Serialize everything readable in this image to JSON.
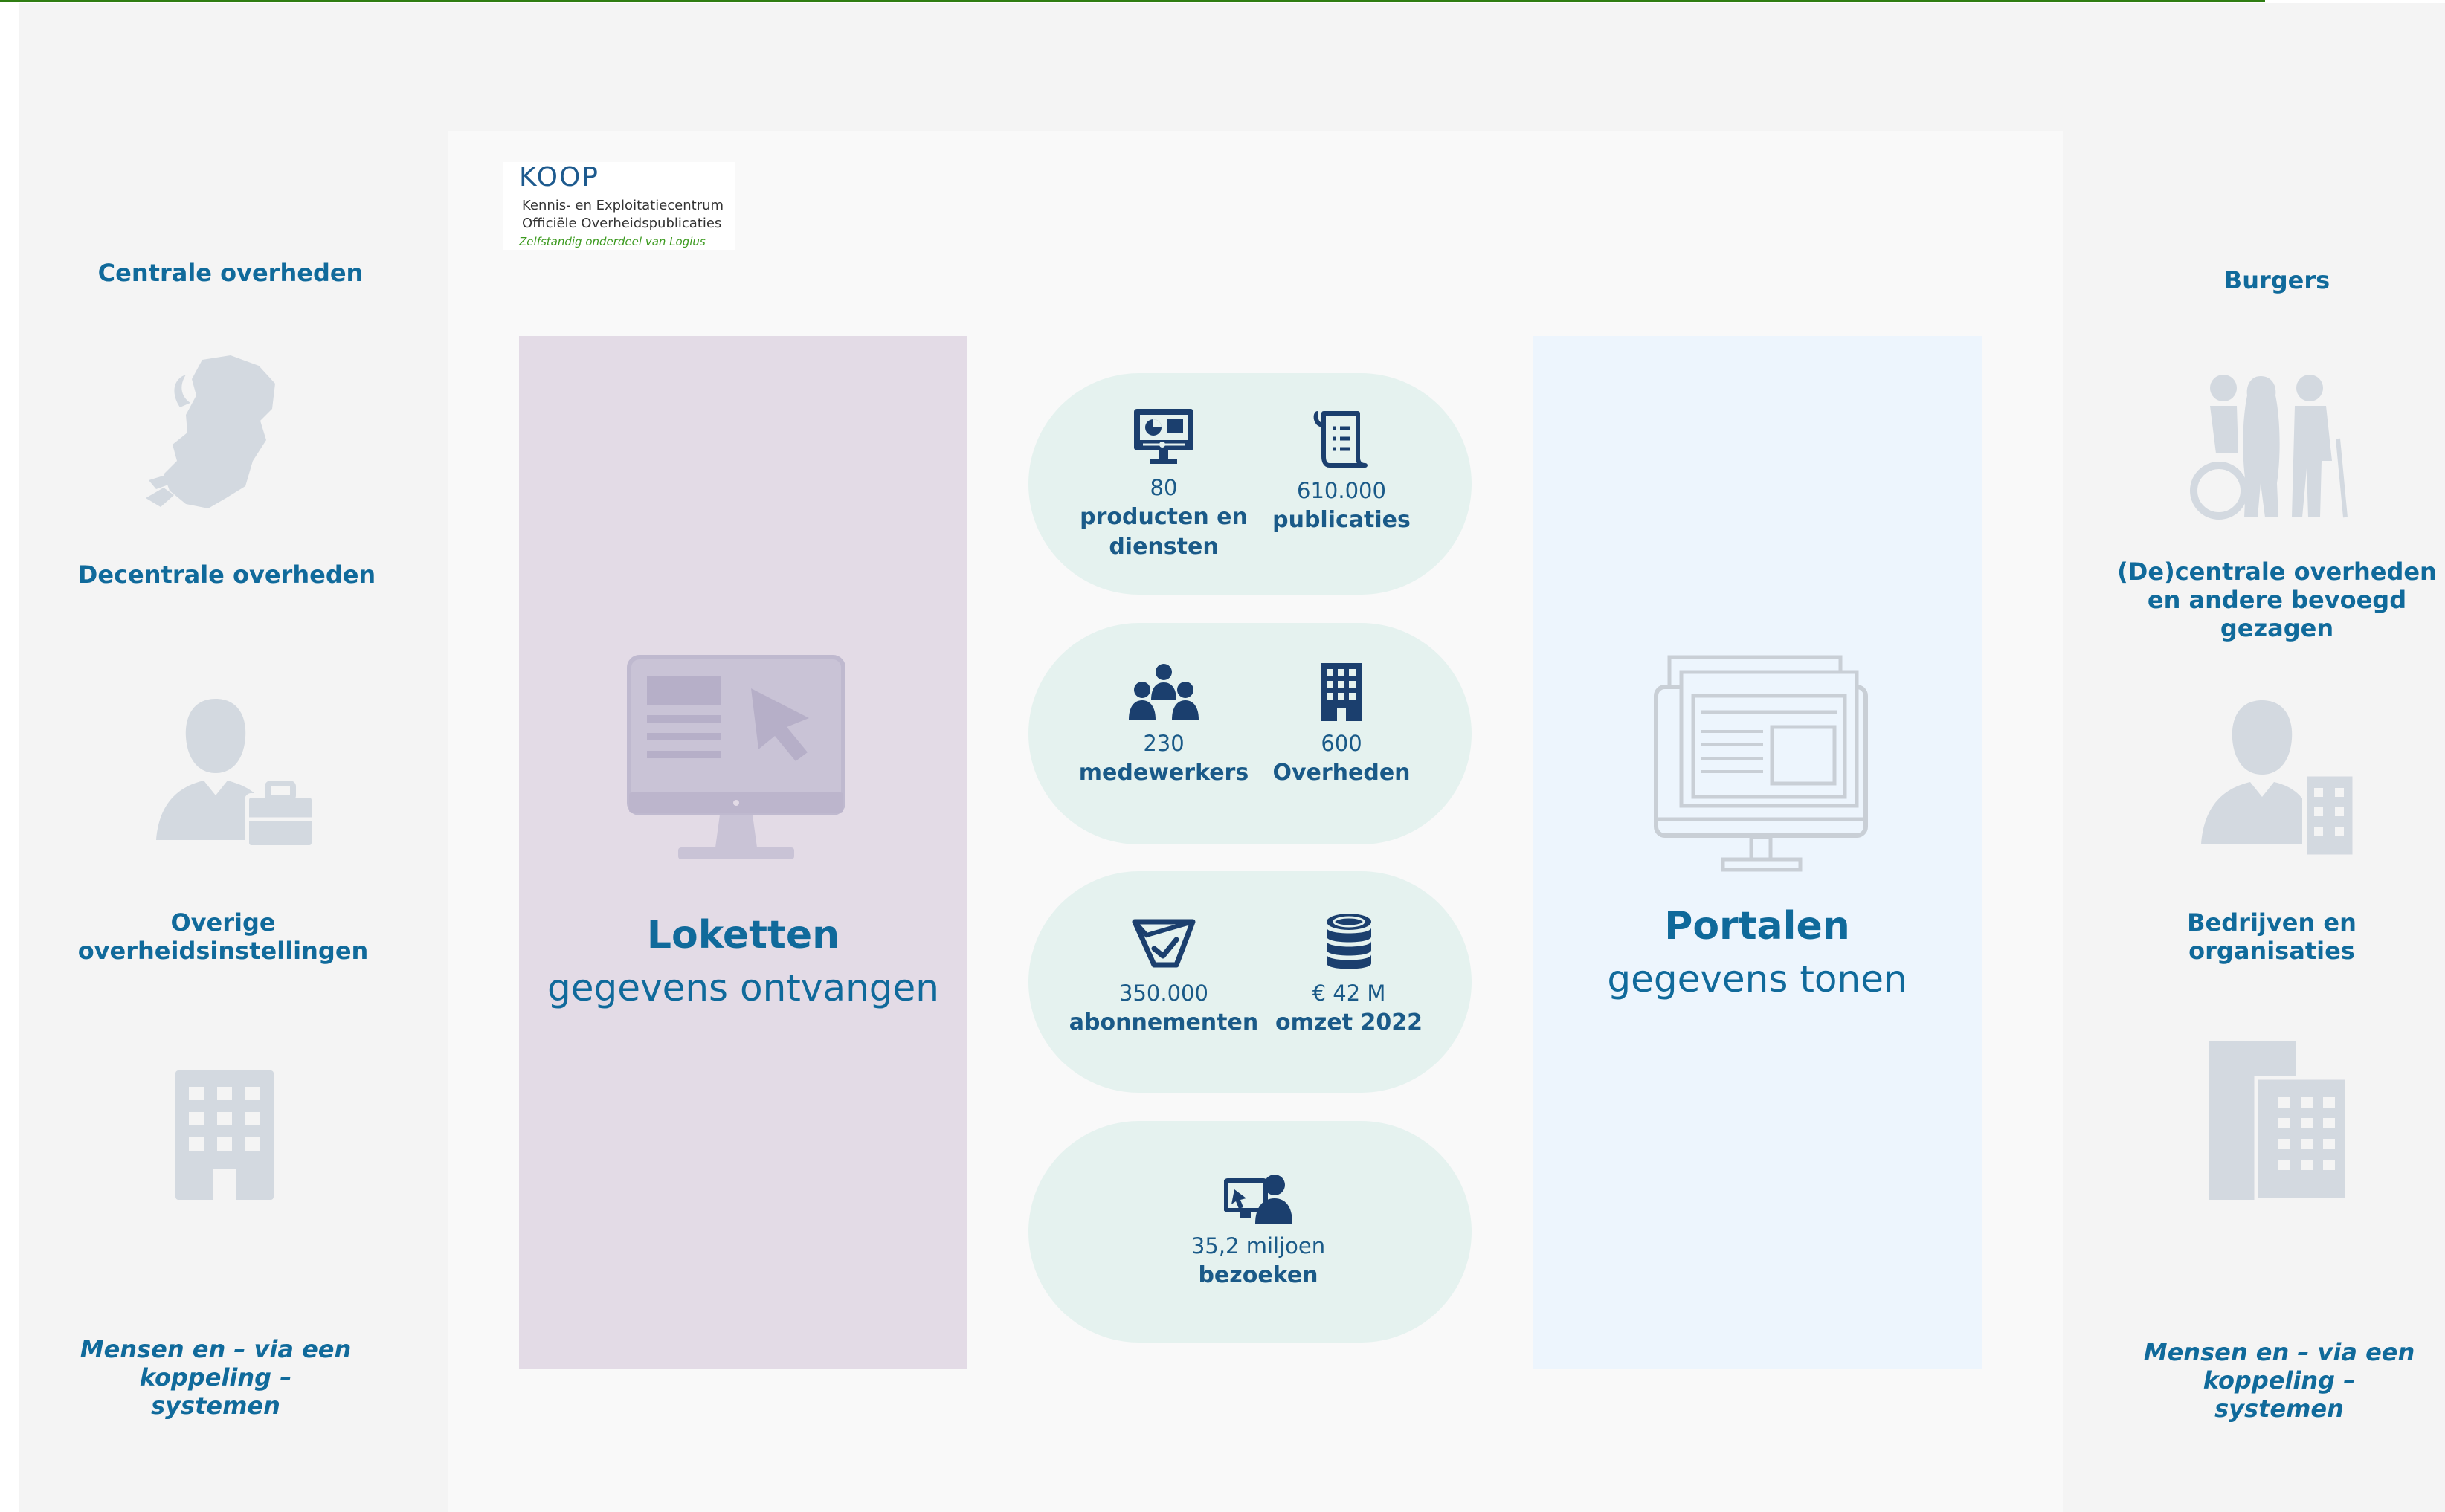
{
  "logo": {
    "title": "KOOP",
    "line1": "Kennis- en Exploitatiecentrum",
    "line2": "Officiële Overheidspublicaties",
    "line3": "Zelfstandig onderdeel van Logius"
  },
  "left_column": {
    "centrale": "Centrale overheden",
    "decentrale": "Decentrale overheden",
    "overige_1": "Overige",
    "overige_2": "overheidsinstellingen",
    "mensen_1": "Mensen en – via een",
    "mensen_2": "koppeling –",
    "mensen_3": "systemen"
  },
  "right_column": {
    "burgers": "Burgers",
    "decentraal_1": "(De)centrale overheden",
    "decentraal_2": "en andere bevoegd",
    "decentraal_3": "gezagen",
    "bedrijven_1": "Bedrijven en",
    "bedrijven_2": "organisaties",
    "mensen_1": "Mensen en – via een",
    "mensen_2": "koppeling –",
    "mensen_3": "systemen"
  },
  "loketten": {
    "title": "Loketten",
    "subtitle": "gegevens ontvangen"
  },
  "portalen": {
    "title": "Portalen",
    "subtitle": "gegevens tonen"
  },
  "stats": {
    "producten": {
      "number": "80",
      "label_1": "producten en",
      "label_2": "diensten",
      "icon": "monitor-chart-icon"
    },
    "publicaties": {
      "number": "610.000",
      "label": "publicaties",
      "icon": "scroll-document-icon"
    },
    "medewerkers": {
      "number": "230",
      "label": "medewerkers",
      "icon": "team-icon"
    },
    "overheden": {
      "number": "600",
      "label": "Overheden",
      "icon": "building-icon"
    },
    "abonnementen": {
      "number": "350.000",
      "label": "abonnementen",
      "icon": "ticket-check-icon"
    },
    "omzet": {
      "number": "€ 42 M",
      "label": "omzet 2022",
      "icon": "coin-stack-icon"
    },
    "bezoeken": {
      "number": "35,2 miljoen",
      "label": "bezoeken",
      "icon": "visitor-screen-icon"
    }
  },
  "colors": {
    "label_blue": "#106a9b",
    "stat_blue": "#1a5a88",
    "icon_dark": "#1b3f6e",
    "icon_grey": "#d3d9e0",
    "loketten_bg": "#e3dbe6",
    "portalen_bg": "#edf5fd",
    "pill_bg": "#e5f2ef",
    "accent_green": "#2f7d12"
  }
}
